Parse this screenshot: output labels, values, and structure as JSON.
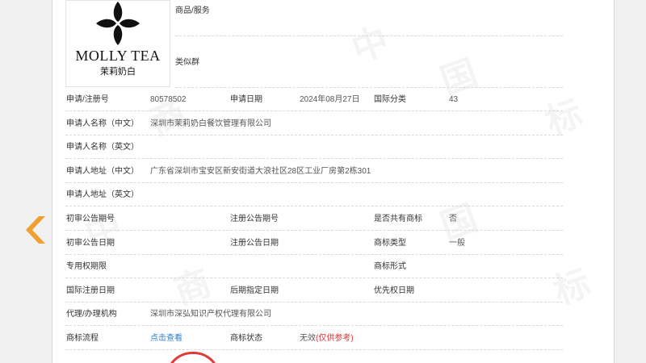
{
  "logo": {
    "brand_en": "MOLLY TEA",
    "brand_cn": "茉莉奶白"
  },
  "header_fields": {
    "goods_services_label": "商品/服务",
    "similar_group_label": "类似群"
  },
  "row1": {
    "reg_no_label": "申请/注册号",
    "reg_no": "80578502",
    "apply_date_label": "申请日期",
    "apply_date": "2024年08月27日",
    "intl_class_label": "国际分类",
    "intl_class": "43"
  },
  "applicant": {
    "name_cn_label": "申请人名称（中文）",
    "name_cn": "深圳市茉莉奶白餐饮管理有限公司",
    "name_en_label": "申请人名称（英文）",
    "addr_cn_label": "申请人地址（中文）",
    "addr_cn": "广东省深圳市宝安区新安街道大浪社区28区工业厂房第2栋301",
    "addr_en_label": "申请人地址（英文）"
  },
  "notice": {
    "prelim_no_label": "初审公告期号",
    "reg_notice_no_label": "注册公告期号",
    "shared_label": "是否共有商标",
    "shared_value": "否",
    "prelim_date_label": "初审公告日期",
    "reg_notice_date_label": "注册公告日期",
    "type_label": "商标类型",
    "type_value": "一般",
    "exclusive_label": "专用权期限",
    "form_label": "商标形式",
    "intl_reg_date_label": "国际注册日期",
    "later_date_label": "后期指定日期",
    "priority_label": "优先权日期"
  },
  "agent": {
    "label": "代理/办理机构",
    "value": "深圳市深弘知识产权代理有限公司"
  },
  "process": {
    "label": "商标流程",
    "link": "点击查看",
    "status_label": "商标状态",
    "status_value": "无效",
    "status_note": "(仅供参考)"
  },
  "watermark": {
    "chars": [
      "中",
      "国",
      "商",
      "标"
    ]
  },
  "colors": {
    "arrow_left": "#f0a030",
    "arrow_right": "#5a9ad8",
    "link": "#2f7fd0",
    "warning": "#dd3333"
  }
}
